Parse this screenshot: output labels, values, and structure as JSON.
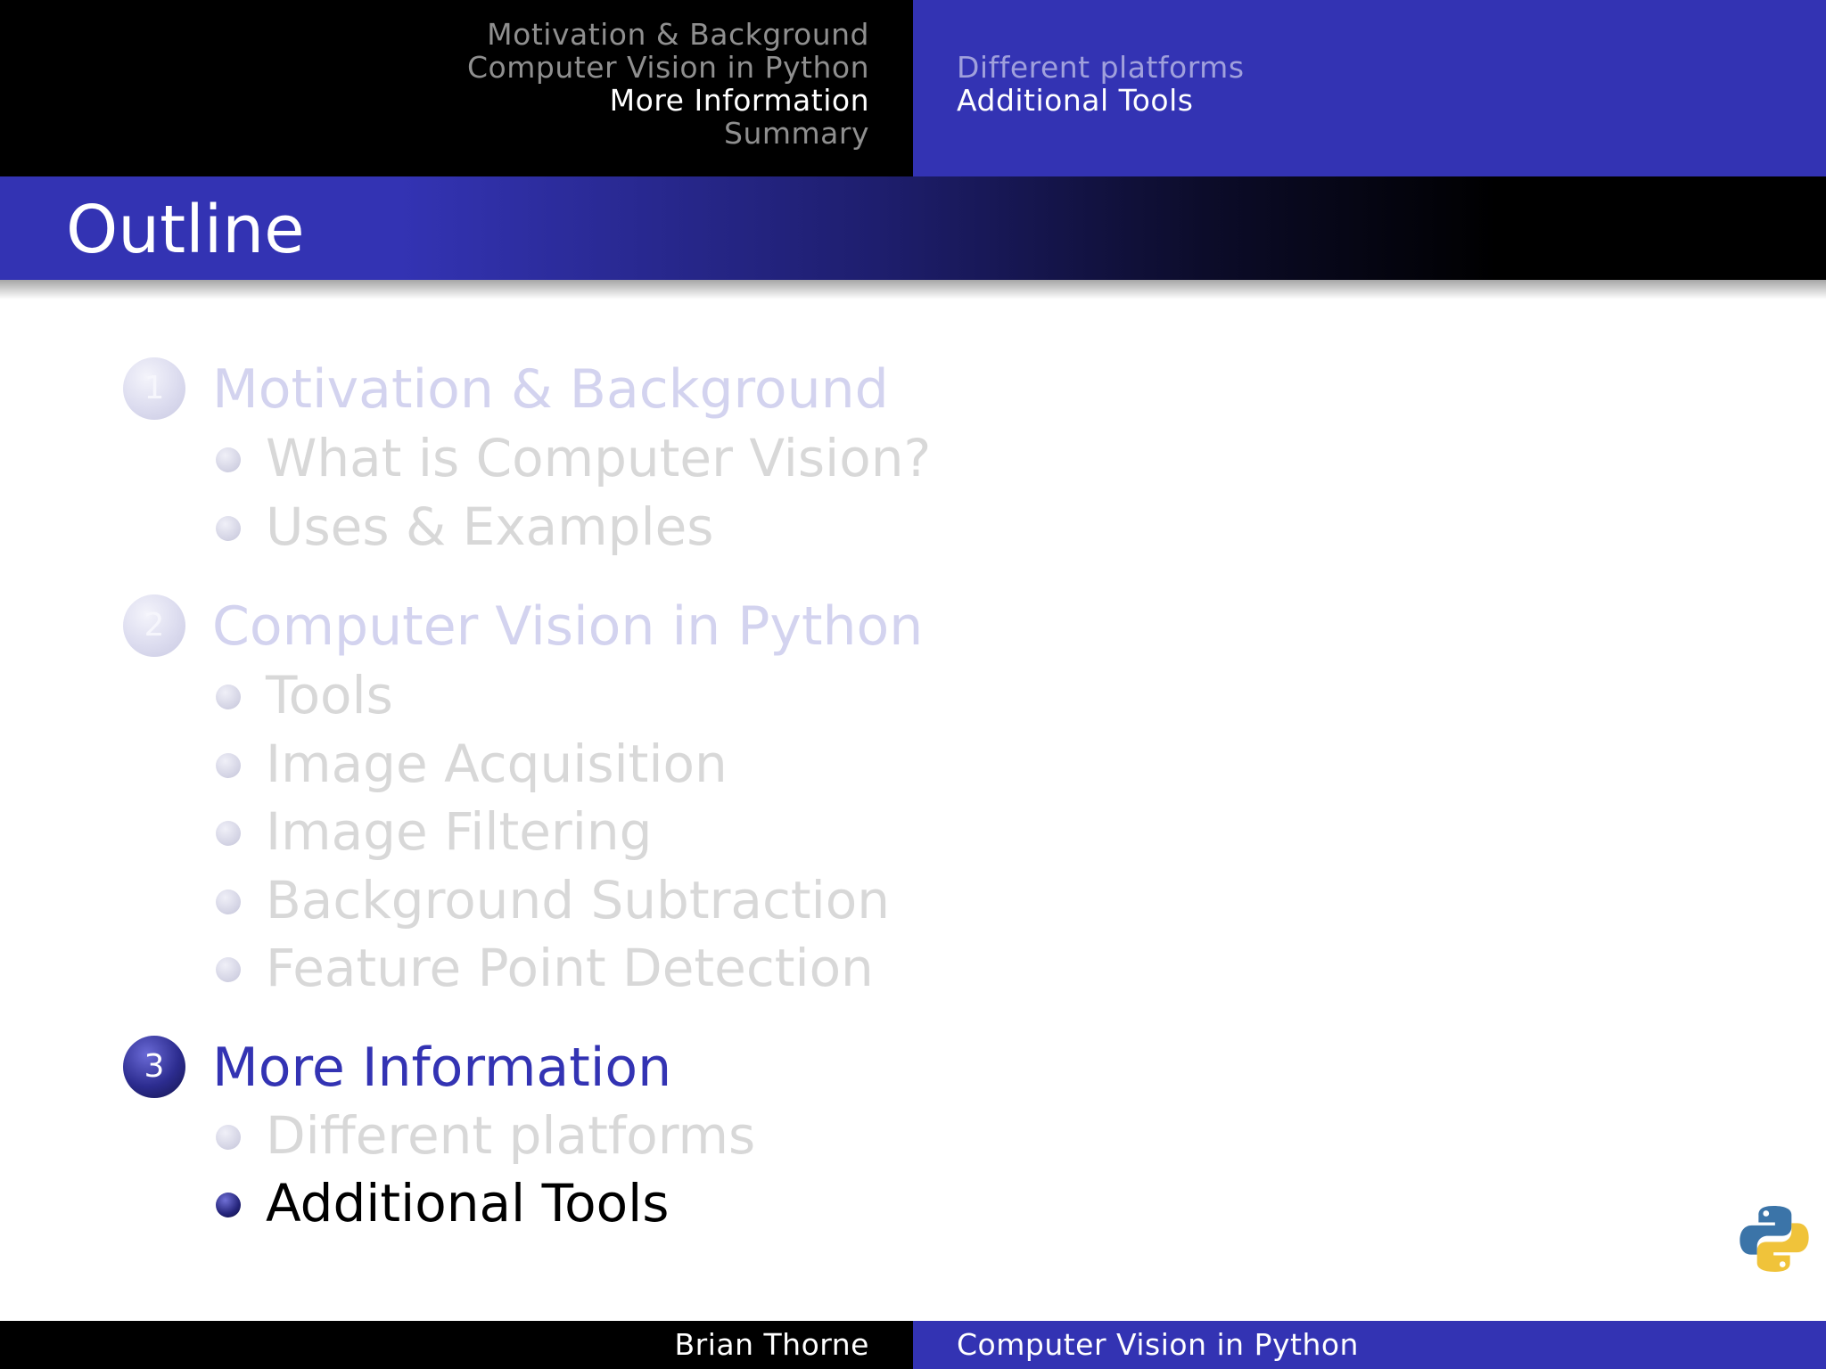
{
  "header": {
    "sections": [
      {
        "label": "Motivation & Background",
        "current": false
      },
      {
        "label": "Computer Vision in Python",
        "current": false
      },
      {
        "label": "More Information",
        "current": true
      },
      {
        "label": "Summary",
        "current": false
      }
    ],
    "subsections": [
      {
        "label": "Different platforms",
        "current": false
      },
      {
        "label": "Additional Tools",
        "current": true
      }
    ]
  },
  "frame": {
    "title": "Outline"
  },
  "outline": {
    "sections": [
      {
        "number": "1",
        "label": "Motivation & Background",
        "active": false,
        "items": [
          {
            "label": "What is Computer Vision?",
            "active": false
          },
          {
            "label": "Uses & Examples",
            "active": false
          }
        ]
      },
      {
        "number": "2",
        "label": "Computer Vision in Python",
        "active": false,
        "items": [
          {
            "label": "Tools",
            "active": false
          },
          {
            "label": "Image Acquisition",
            "active": false
          },
          {
            "label": "Image Filtering",
            "active": false
          },
          {
            "label": "Background Subtraction",
            "active": false
          },
          {
            "label": "Feature Point Detection",
            "active": false
          }
        ]
      },
      {
        "number": "3",
        "label": "More Information",
        "active": true,
        "items": [
          {
            "label": "Different platforms",
            "active": false
          },
          {
            "label": "Additional Tools",
            "active": true
          }
        ]
      }
    ]
  },
  "logo": {
    "icon": "python-logo-icon",
    "colors": {
      "blue": "#3b74a8",
      "yellow": "#f0c33a"
    }
  },
  "footer": {
    "author": "Brian Thorne",
    "title": "Computer Vision in Python"
  },
  "colors": {
    "accent": "#3333b3",
    "header_dark": "#000000"
  }
}
